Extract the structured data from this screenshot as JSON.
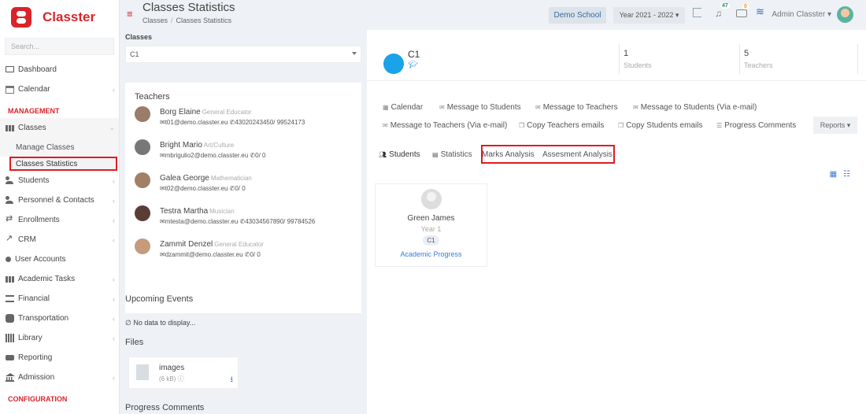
{
  "app": {
    "name": "Classter"
  },
  "sidebar": {
    "search_placeholder": "Search...",
    "items": [
      {
        "label": "Dashboard"
      },
      {
        "label": "Calendar"
      }
    ],
    "section_management": "MANAGEMENT",
    "classes": {
      "label": "Classes",
      "subs": [
        "Manage Classes",
        "Classes Statistics"
      ]
    },
    "more": [
      {
        "label": "Students"
      },
      {
        "label": "Personnel & Contacts"
      },
      {
        "label": "Enrollments"
      },
      {
        "label": "CRM"
      },
      {
        "label": "User Accounts"
      },
      {
        "label": "Academic Tasks"
      },
      {
        "label": "Financial"
      },
      {
        "label": "Transportation"
      },
      {
        "label": "Library"
      },
      {
        "label": "Reporting"
      },
      {
        "label": "Admission"
      }
    ],
    "section_configuration": "CONFIGURATION"
  },
  "header": {
    "title": "Classes Statistics",
    "breadcrumb": [
      "Classes",
      "Classes Statistics"
    ],
    "school": "Demo School",
    "year": "Year 2021 - 2022 ▾",
    "notifications_count": "47",
    "messages_count": "0",
    "user": "Admin Classter ▾"
  },
  "left": {
    "classes_label": "Classes",
    "selected_class": "C1",
    "teachers_title": "Teachers",
    "teachers": [
      {
        "name": "Borg Elaine",
        "role": "General Educator",
        "contact": "✉t01@demo.classter.eu ✆43020243450/ 99524173",
        "color": "#9b7b6a"
      },
      {
        "name": "Bright Mario",
        "role": "Art/Culture",
        "contact": "✉mbrigulio2@demo.classter.eu ✆0/ 0",
        "color": "#777777"
      },
      {
        "name": "Galea George",
        "role": "Mathematician",
        "contact": "✉t02@demo.classter.eu ✆0/ 0",
        "color": "#a08066"
      },
      {
        "name": "Testra Martha",
        "role": "Musician",
        "contact": "✉mtesta@demo.classter.eu ✆43034567890/ 99784526",
        "color": "#5a3d34"
      },
      {
        "name": "Zammit Denzel",
        "role": "General Educator",
        "contact": "✉dzammit@demo.classter.eu ✆0/ 0",
        "color": "#c59a7d"
      }
    ],
    "upcoming_title": "Upcoming Events",
    "no_data": "No data to display...",
    "files_title": "Files",
    "file": {
      "name": "images",
      "size": "(6 kB)"
    },
    "progress_title": "Progress Comments"
  },
  "right": {
    "class_name": "C1",
    "students_count": "1",
    "students_label": "Students",
    "teachers_count": "5",
    "teachers_label": "Teachers",
    "actions": [
      "Calendar",
      "Message to Students",
      "Message to Teachers",
      "Message to Students (Via e-mail)",
      "Message to Teachers (Via e-mail)",
      "Copy Teachers emails",
      "Copy Students emails",
      "Progress Comments"
    ],
    "reports": "Reports ▾",
    "tabs": [
      "Students",
      "Statistics",
      "Marks Analysis",
      "Assesment Analysis"
    ],
    "student": {
      "name": "Green James",
      "year": "Year 1",
      "class": "C1",
      "link": "Academic Progress"
    }
  },
  "colors": {
    "brand": "#d9242b",
    "highlight": "#e11b22",
    "accent": "#3a7bd5",
    "class_circle": "#1aa3e8"
  }
}
